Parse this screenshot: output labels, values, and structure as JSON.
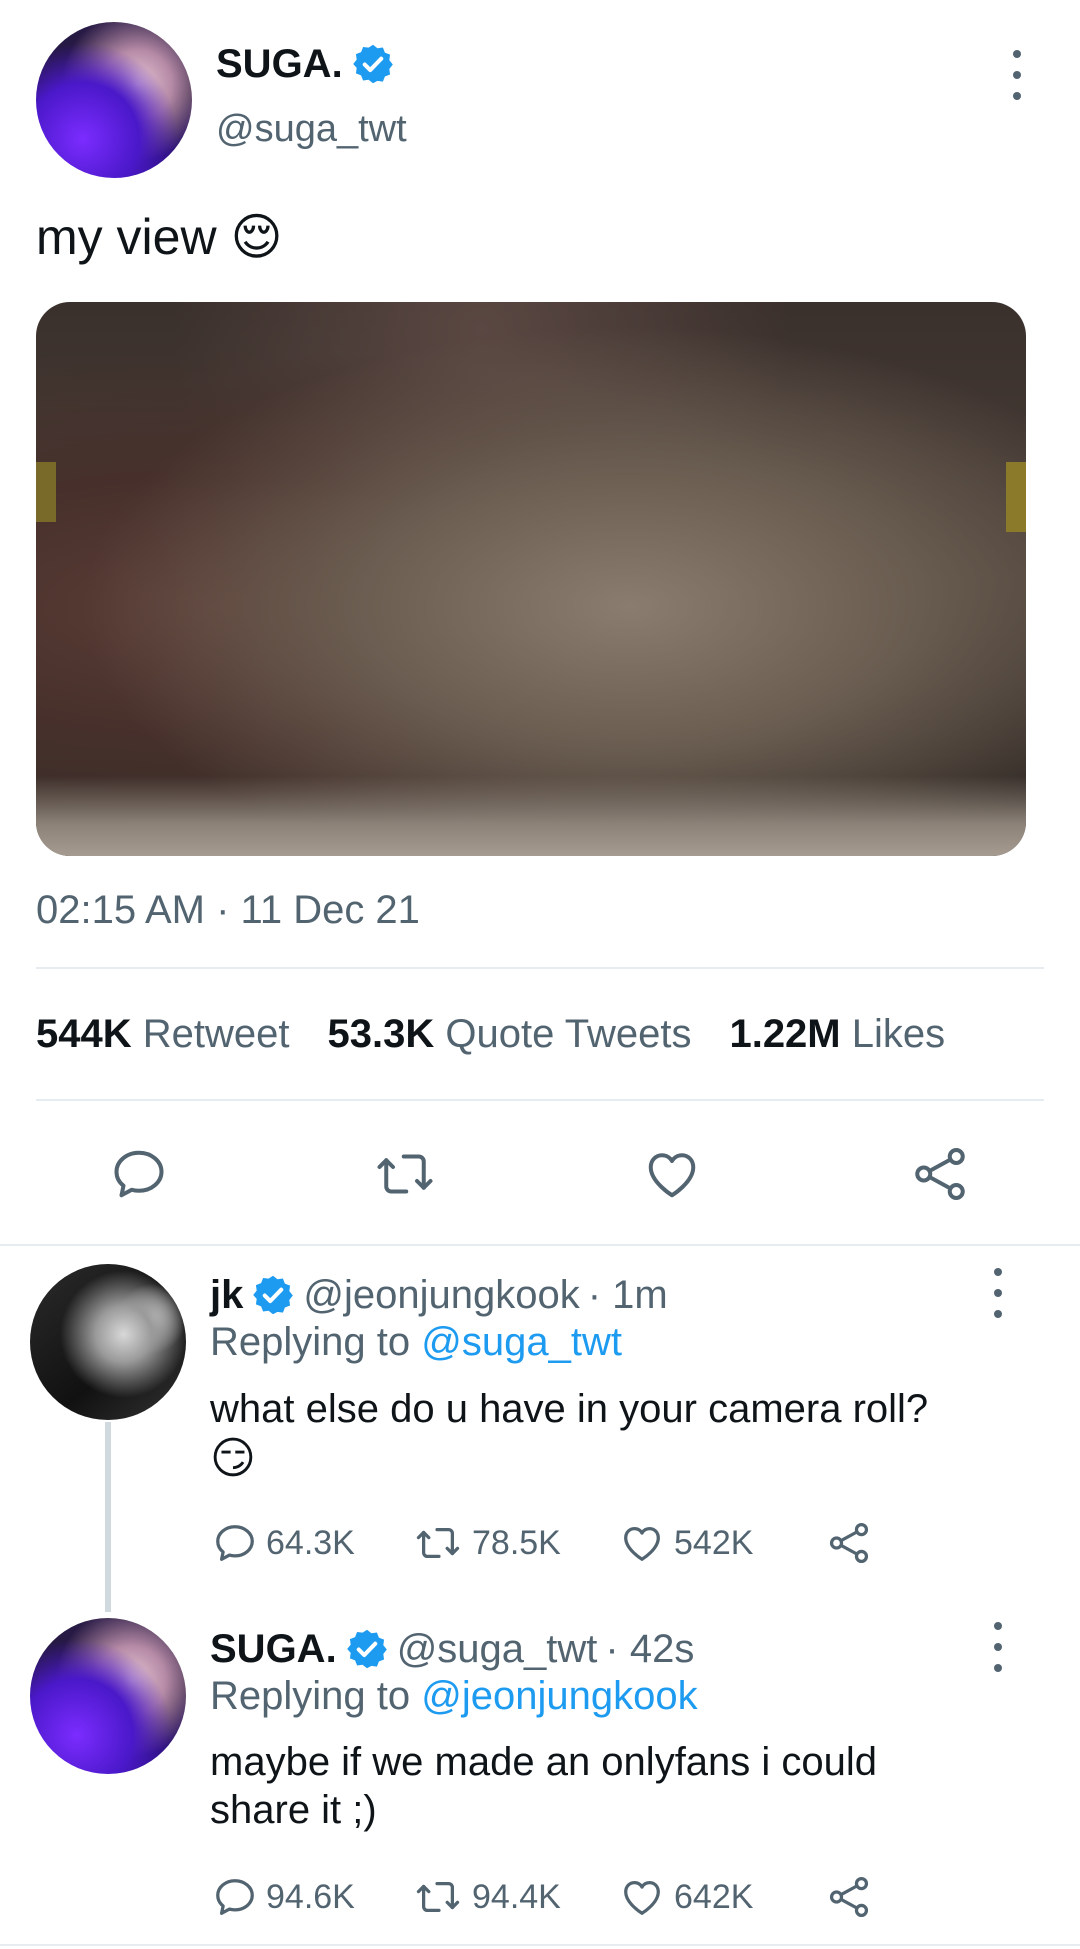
{
  "main_tweet": {
    "author_name": "SUGA.",
    "author_handle": "@suga_twt",
    "text": "my view 😌",
    "timestamp": "02:15 AM · 11 Dec 21",
    "stats": {
      "retweets_count": "544K",
      "retweets_label": "Retweet",
      "quotes_count": "53.3K",
      "quotes_label": "Quote Tweets",
      "likes_count": "1.22M",
      "likes_label": "Likes"
    }
  },
  "replies": [
    {
      "author_name": "jk",
      "author_handle": "@jeonjungkook",
      "time": "· 1m",
      "replying_prefix": "Replying to",
      "replying_handle": "@suga_twt",
      "text_line1": "what else do u have in your camera roll?",
      "text_line2": "😏",
      "replies_count": "64.3K",
      "retweets_count": "78.5K",
      "likes_count": "542K"
    },
    {
      "author_name": "SUGA.",
      "author_handle": "@suga_twt",
      "time": "· 42s",
      "replying_prefix": "Replying to",
      "replying_handle": "@jeonjungkook",
      "text_line1": "maybe if we made an onlyfans i could",
      "text_line2": "share it ;)",
      "replies_count": "94.6K",
      "retweets_count": "94.4K",
      "likes_count": "642K"
    }
  ],
  "icons": [
    "verified-badge-icon",
    "more-options-icon",
    "reply-icon",
    "retweet-icon",
    "like-icon",
    "share-icon"
  ],
  "colors": {
    "accent": "#1d9bf0",
    "muted": "#536471",
    "text": "#0f1419",
    "divider": "#e6ecf0"
  }
}
